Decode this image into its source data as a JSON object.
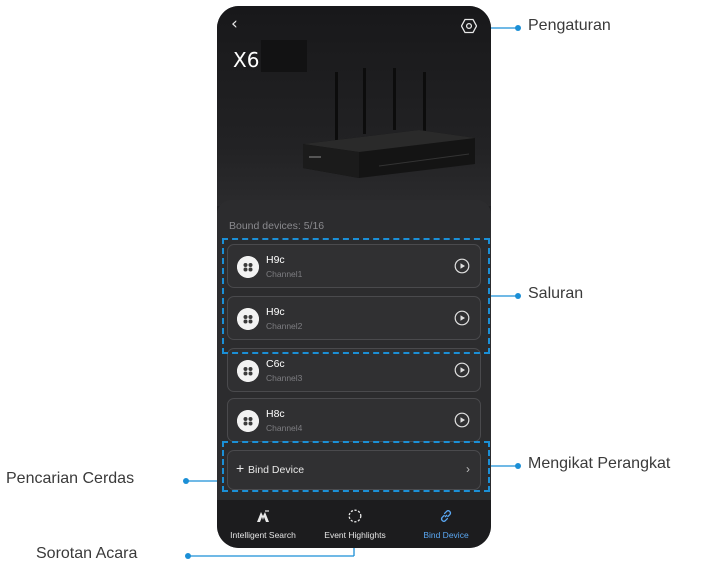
{
  "device": {
    "title": "X6",
    "back_icon": "chevron-left-icon",
    "settings_icon": "settings-gear-icon"
  },
  "bound_devices_text": "Bound devices: 5/16",
  "channels": [
    {
      "name": "H9c",
      "channel": "Channel1"
    },
    {
      "name": "H9c",
      "channel": "Channel2"
    },
    {
      "name": "C6c",
      "channel": "Channel3"
    },
    {
      "name": "H8c",
      "channel": "Channel4"
    }
  ],
  "bind_row": {
    "plus": "+",
    "label": "Bind Device",
    "chevron": "›"
  },
  "tabs": [
    {
      "label": "Intelligent Search",
      "icon": "intelligent-search-icon"
    },
    {
      "label": "Event Highlights",
      "icon": "event-highlights-icon"
    },
    {
      "label": "Bind Device",
      "icon": "link-icon"
    }
  ],
  "active_tab": "Bind Device",
  "callouts": {
    "settings": "Pengaturan",
    "channels": "Saluran",
    "bind": "Mengikat Perangkat",
    "search": "Pencarian Cerdas",
    "events": "Sorotan Acara"
  },
  "colors": {
    "accent": "#5aa7f2",
    "highlight": "#1b8fd6"
  }
}
